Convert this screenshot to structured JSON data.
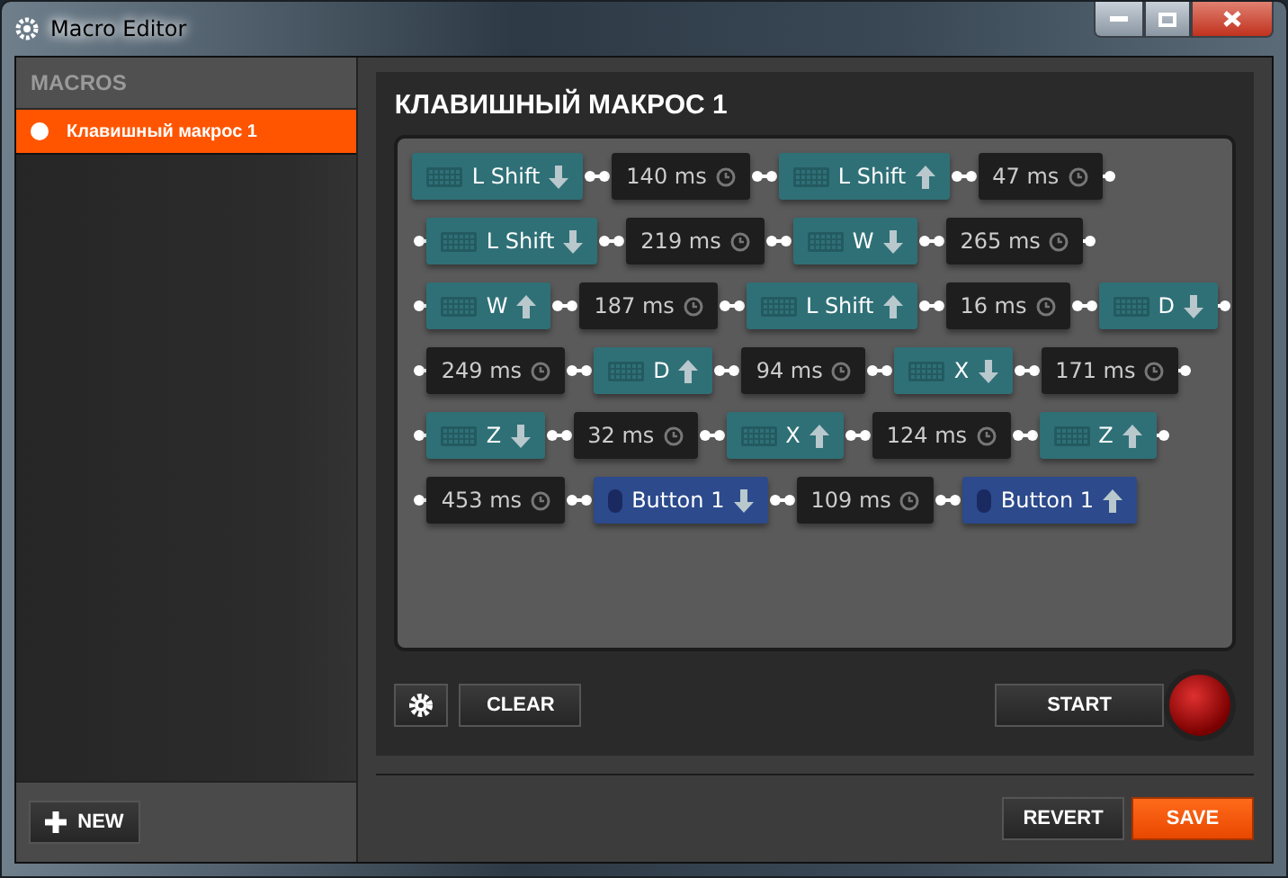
{
  "window": {
    "title": "Macro Editor"
  },
  "sidebar": {
    "heading": "MACROS",
    "items": [
      {
        "label": "Клавишный макрос 1",
        "selected": true
      }
    ],
    "new_button": "NEW"
  },
  "editor": {
    "title": "КЛАВИШНЫЙ МАКРОС 1",
    "rows": [
      [
        {
          "kind": "key",
          "label": "L Shift",
          "down": true
        },
        {
          "kind": "delay",
          "label": "140 ms"
        },
        {
          "kind": "key",
          "label": "L Shift",
          "down": false
        },
        {
          "kind": "delay",
          "label": "47 ms"
        }
      ],
      [
        {
          "kind": "key",
          "label": "L Shift",
          "down": true
        },
        {
          "kind": "delay",
          "label": "219 ms"
        },
        {
          "kind": "key",
          "label": "W",
          "down": true
        },
        {
          "kind": "delay",
          "label": "265 ms"
        }
      ],
      [
        {
          "kind": "key",
          "label": "W",
          "down": false
        },
        {
          "kind": "delay",
          "label": "187 ms"
        },
        {
          "kind": "key",
          "label": "L Shift",
          "down": false
        },
        {
          "kind": "delay",
          "label": "16 ms"
        },
        {
          "kind": "key",
          "label": "D",
          "down": true
        }
      ],
      [
        {
          "kind": "delay",
          "label": "249 ms"
        },
        {
          "kind": "key",
          "label": "D",
          "down": false
        },
        {
          "kind": "delay",
          "label": "94 ms"
        },
        {
          "kind": "key",
          "label": "X",
          "down": true
        },
        {
          "kind": "delay",
          "label": "171 ms"
        }
      ],
      [
        {
          "kind": "key",
          "label": "Z",
          "down": true
        },
        {
          "kind": "delay",
          "label": "32 ms"
        },
        {
          "kind": "key",
          "label": "X",
          "down": false
        },
        {
          "kind": "delay",
          "label": "124 ms"
        },
        {
          "kind": "key",
          "label": "Z",
          "down": false
        }
      ],
      [
        {
          "kind": "delay",
          "label": "453 ms"
        },
        {
          "kind": "mouse",
          "label": "Button 1",
          "down": true
        },
        {
          "kind": "delay",
          "label": "109 ms"
        },
        {
          "kind": "mouse",
          "label": "Button 1",
          "down": false
        }
      ]
    ],
    "clear_button": "CLEAR",
    "start_button": "START"
  },
  "footer": {
    "revert_button": "REVERT",
    "save_button": "SAVE"
  }
}
